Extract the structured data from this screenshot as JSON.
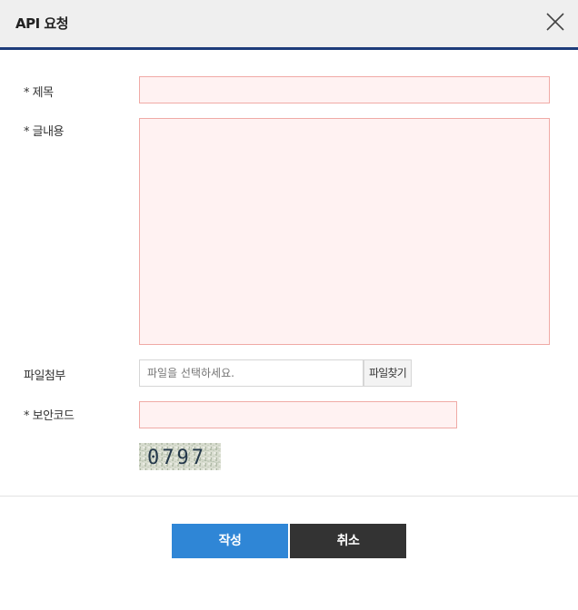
{
  "dialog": {
    "title": "API 요청"
  },
  "form": {
    "title_label": "* 제목",
    "title_value": "",
    "content_label": "* 글내용",
    "content_value": "",
    "attachment_label": "파일첨부",
    "attachment_placeholder": "파일을 선택하세요.",
    "attachment_button": "파일찾기",
    "captcha_label": "* 보안코드",
    "captcha_value": "",
    "captcha_image_text": "0797"
  },
  "actions": {
    "submit_label": "작성",
    "cancel_label": "취소"
  },
  "colors": {
    "header_bar": "#1d3c7a",
    "submit": "#2f86d6",
    "cancel": "#333333",
    "required_field_bg": "#fff2f2",
    "required_field_border": "#f0aaa6"
  }
}
